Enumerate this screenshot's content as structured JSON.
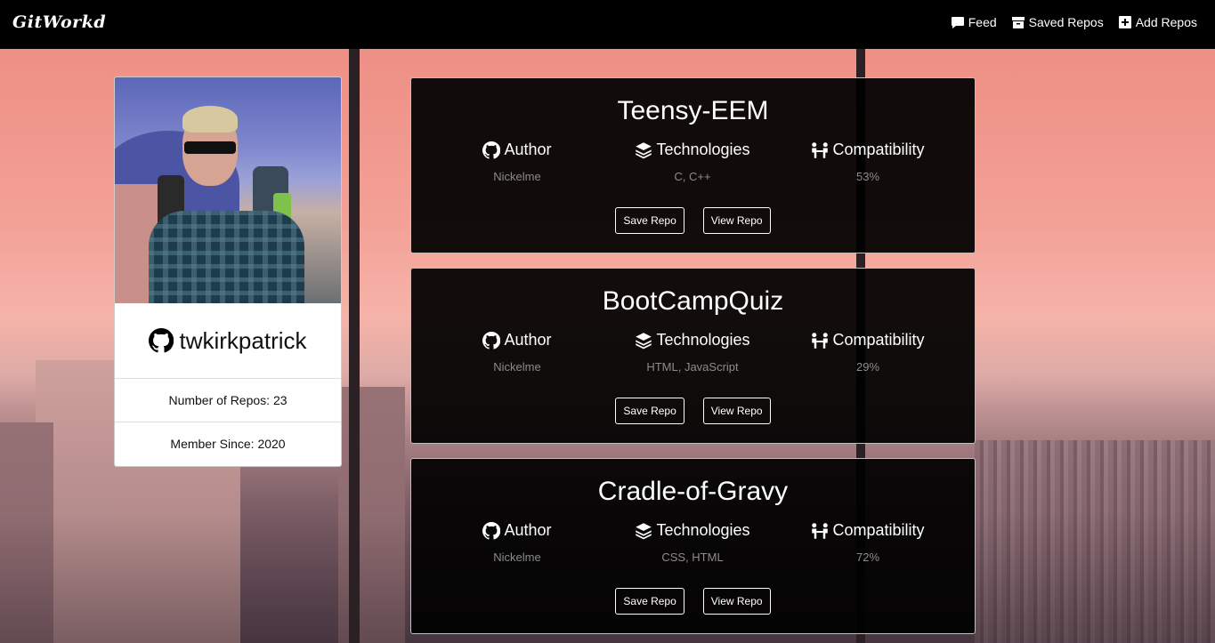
{
  "nav": {
    "brand": "GitWorkd",
    "links": [
      {
        "label": "Feed",
        "icon": "comment-icon"
      },
      {
        "label": "Saved Repos",
        "icon": "archive-icon"
      },
      {
        "label": "Add Repos",
        "icon": "plus-square-icon"
      }
    ]
  },
  "profile": {
    "username": "twkirkpatrick",
    "repos": "Number of Repos: 23",
    "member_since": "Member Since: 2020"
  },
  "labels": {
    "author": "Author",
    "technologies": "Technologies",
    "compatibility": "Compatibility",
    "save": "Save Repo",
    "view": "View Repo"
  },
  "repos": [
    {
      "name": "Teensy-EEM",
      "author": "Nickelme",
      "technologies": "C, C++",
      "compatibility": "53%"
    },
    {
      "name": "BootCampQuiz",
      "author": "Nickelme",
      "technologies": "HTML, JavaScript",
      "compatibility": "29%"
    },
    {
      "name": "Cradle-of-Gravy",
      "author": "Nickelme",
      "technologies": "CSS, HTML",
      "compatibility": "72%"
    }
  ]
}
